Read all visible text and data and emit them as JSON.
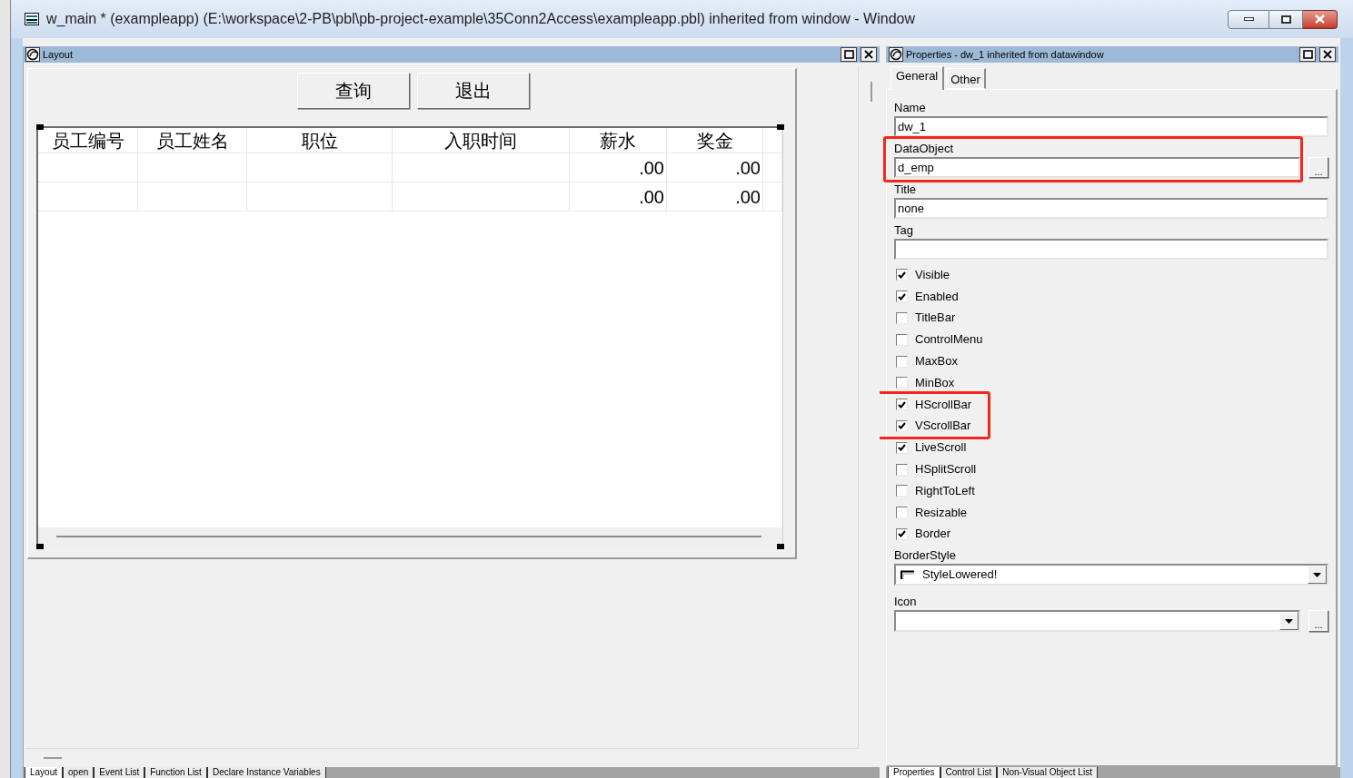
{
  "window": {
    "title": "w_main * (exampleapp) (E:\\workspace\\2-PB\\pbl\\pb-project-example\\35Conn2Access\\exampleapp.pbl) inherited from window - Window"
  },
  "layout_panel": {
    "title": "Layout",
    "buttons": [
      "查询",
      "退出"
    ],
    "table": {
      "columns": [
        {
          "label": "员工编号"
        },
        {
          "label": "员工姓名"
        },
        {
          "label": "职位"
        },
        {
          "label": "入职时间"
        },
        {
          "label": "薪水",
          "cells": [
            ".00",
            ".00"
          ]
        },
        {
          "label": "奖金",
          "cells": [
            ".00",
            ".00"
          ]
        }
      ]
    },
    "sheet_tabs": [
      {
        "label": "Layout",
        "selected": true
      },
      {
        "label": "open",
        "selected": false
      },
      {
        "label": "Event List",
        "selected": false
      },
      {
        "label": "Function List",
        "selected": false
      },
      {
        "label": "Declare Instance Variables",
        "selected": false
      }
    ]
  },
  "properties_panel": {
    "title": "Properties - dw_1 inherited from datawindow",
    "tabs": [
      {
        "label": "General",
        "selected": true
      },
      {
        "label": "Other",
        "selected": false
      }
    ],
    "items": [
      {
        "kind": "text",
        "label": "Name",
        "value": "dw_1",
        "highlighted": false
      },
      {
        "kind": "text",
        "label": "DataObject",
        "value": "d_emp",
        "button": "...",
        "highlighted": true
      },
      {
        "kind": "text",
        "label": "Title",
        "value": "none",
        "highlighted": false
      },
      {
        "kind": "text",
        "label": "Tag",
        "highlighted": false
      },
      {
        "kind": "checkbox",
        "label": "Visible",
        "checked": true,
        "highlighted": false
      },
      {
        "kind": "checkbox",
        "label": "Enabled",
        "checked": true,
        "highlighted": false
      },
      {
        "kind": "checkbox",
        "label": "TitleBar",
        "checked": false,
        "highlighted": false
      },
      {
        "kind": "checkbox",
        "label": "ControlMenu",
        "checked": false,
        "highlighted": false
      },
      {
        "kind": "checkbox",
        "label": "MaxBox",
        "checked": false,
        "highlighted": false
      },
      {
        "kind": "checkbox",
        "label": "MinBox",
        "checked": false,
        "highlighted": false
      },
      {
        "kind": "checkbox",
        "label": "HScrollBar",
        "checked": true,
        "highlighted": true
      },
      {
        "kind": "checkbox",
        "label": "VScrollBar",
        "checked": true,
        "highlighted": true
      },
      {
        "kind": "checkbox",
        "label": "LiveScroll",
        "checked": true,
        "highlighted": false
      },
      {
        "kind": "checkbox",
        "label": "HSplitScroll",
        "checked": false,
        "highlighted": false
      },
      {
        "kind": "checkbox",
        "label": "RightToLeft",
        "checked": false,
        "highlighted": false
      },
      {
        "kind": "checkbox",
        "label": "Resizable",
        "checked": false,
        "highlighted": false
      },
      {
        "kind": "checkbox",
        "label": "Border",
        "checked": true,
        "highlighted": false
      },
      {
        "kind": "dropdown",
        "label": "BorderStyle",
        "value": "StyleLowered!",
        "highlighted": false
      },
      {
        "kind": "dropdown",
        "label": "Icon",
        "button": "...",
        "highlighted": false
      }
    ],
    "sheet_tabs": [
      {
        "label": "Properties",
        "selected": true
      },
      {
        "label": "Control List",
        "selected": false
      },
      {
        "label": "Non-Visual Object List",
        "selected": false
      }
    ]
  }
}
